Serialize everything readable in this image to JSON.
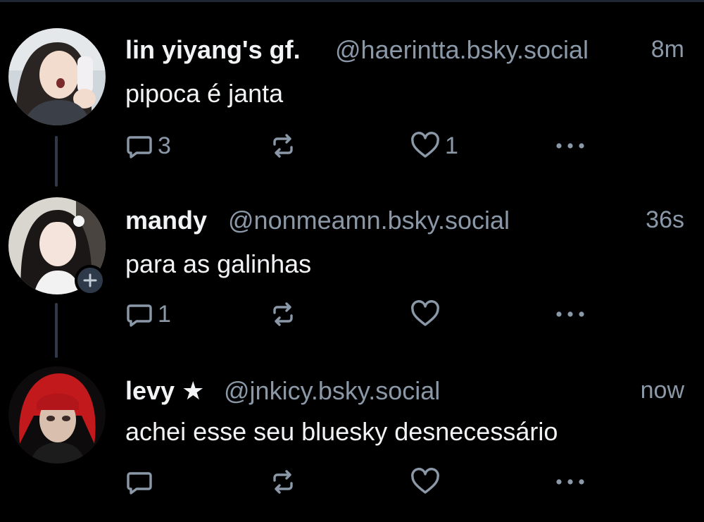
{
  "colors": {
    "background": "#000000",
    "muted": "#8a98a8",
    "text": "#f1f3f5",
    "thread_line": "#2e3a4a"
  },
  "posts": [
    {
      "display_name": "lin yiyang's gf.",
      "handle": "@haerintta.bsky.social",
      "time": "8m",
      "text": "pipoca é janta",
      "reply_count": "3",
      "repost_count": "",
      "like_count": "1",
      "avatar_icon": "avatar-photo"
    },
    {
      "display_name": "mandy",
      "handle": "@nonmeamn.bsky.social",
      "time": "36s",
      "text": "para as galinhas",
      "reply_count": "1",
      "repost_count": "",
      "like_count": "",
      "avatar_icon": "avatar-photo",
      "follow_badge_icon": "plus-icon"
    },
    {
      "display_name": "levy ★",
      "handle": "@jnkicy.bsky.social",
      "time": "now",
      "text": "achei esse seu bluesky desnecessário",
      "reply_count": "",
      "repost_count": "",
      "like_count": "",
      "avatar_icon": "avatar-photo"
    }
  ]
}
